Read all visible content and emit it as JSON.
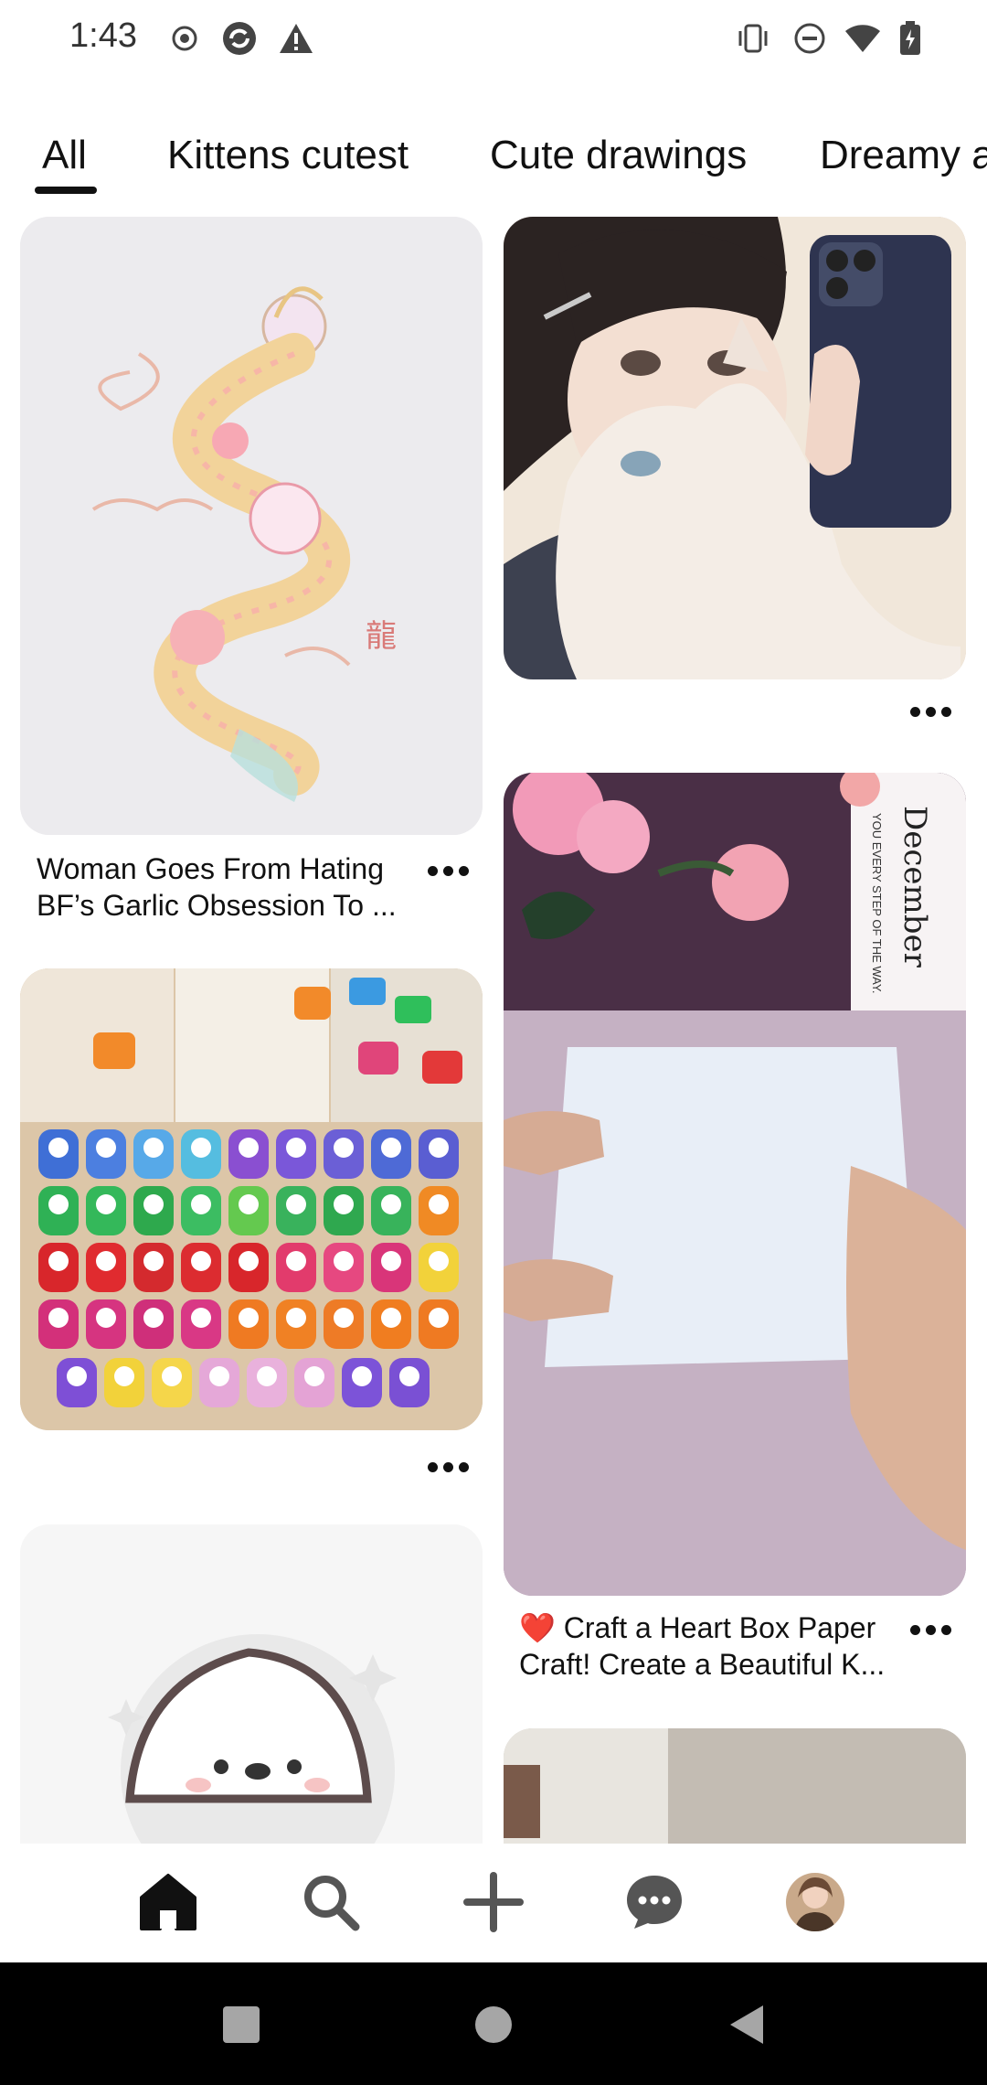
{
  "status_bar": {
    "time": "1:43",
    "icons": [
      "record-icon",
      "sync-icon",
      "warning-icon",
      "vibrate-icon",
      "dnd-icon",
      "wifi-icon",
      "battery-charging-icon"
    ]
  },
  "tabs": [
    {
      "label": "All",
      "selected": true
    },
    {
      "label": "Kittens cutest",
      "selected": false
    },
    {
      "label": "Cute drawings",
      "selected": false
    },
    {
      "label": "Dreamy a",
      "selected": false
    }
  ],
  "pins": {
    "dragon": {
      "title_line1": "Woman Goes From Hating",
      "title_line2": "BF’s Garlic Obsession To ..."
    },
    "girl_cat": {
      "title_line1": "",
      "title_line2": ""
    },
    "craft_punches": {
      "title_line1": "",
      "title_line2": ""
    },
    "heart_box": {
      "title_line1": "❤️ Craft a Heart Box Paper",
      "title_line2": "Craft! Create a Beautiful K...",
      "calendar_text": "December",
      "calendar_subtext": "YOU EVERY STEP OF THE WAY."
    },
    "chick": {
      "title_line1": "",
      "title_line2": ""
    }
  },
  "bottom_nav": {
    "items": [
      {
        "name": "home-icon",
        "selected": true
      },
      {
        "name": "search-icon",
        "selected": false
      },
      {
        "name": "create-plus-icon",
        "selected": false
      },
      {
        "name": "messages-icon",
        "selected": false
      },
      {
        "name": "profile-avatar",
        "selected": false
      }
    ]
  },
  "system_nav": {
    "items": [
      "recents-square-icon",
      "home-circle-icon",
      "back-triangle-icon"
    ]
  },
  "colors": {
    "accent": "#111111",
    "background": "#ffffff",
    "icon_gray": "#555555"
  }
}
